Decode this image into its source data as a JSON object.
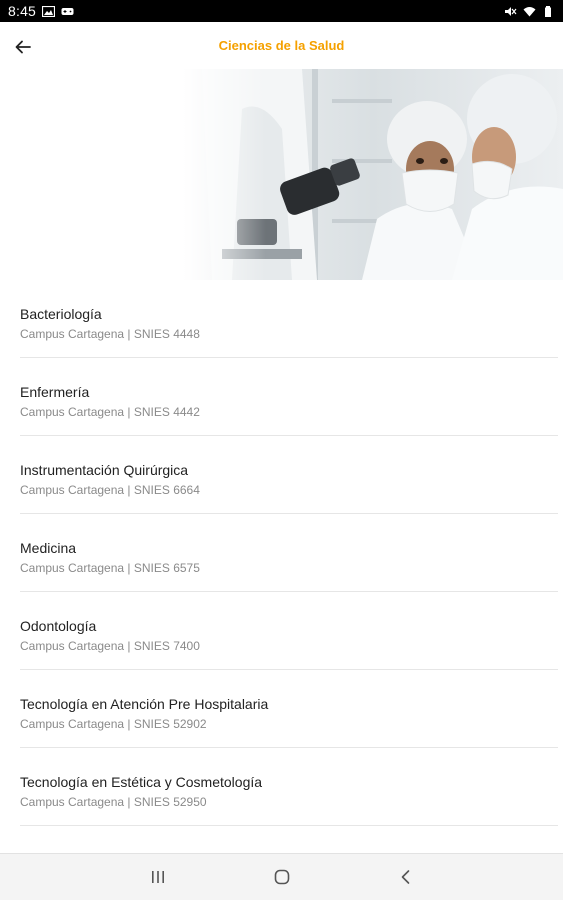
{
  "status_bar": {
    "time": "8:45",
    "icons": [
      "image-icon",
      "gamepad-icon",
      "mute-icon",
      "wifi-icon",
      "battery-icon"
    ]
  },
  "app_bar": {
    "title": "Ciencias de la Salud",
    "back_icon": "arrow-left-icon",
    "title_color": "#f5a100"
  },
  "hero": {
    "image": "laboratory-researchers-with-microscope"
  },
  "programs": [
    {
      "name": "Bacteriología",
      "details": "Campus Cartagena | SNIES 4448"
    },
    {
      "name": "Enfermería",
      "details": "Campus Cartagena | SNIES 4442"
    },
    {
      "name": "Instrumentación Quirúrgica",
      "details": "Campus Cartagena | SNIES 6664"
    },
    {
      "name": "Medicina",
      "details": "Campus Cartagena | SNIES 6575"
    },
    {
      "name": "Odontología",
      "details": "Campus Cartagena | SNIES 7400"
    },
    {
      "name": "Tecnología en Atención Pre Hospitalaria",
      "details": "Campus Cartagena | SNIES 52902"
    },
    {
      "name": "Tecnología en Estética y Cosmetología",
      "details": "Campus Cartagena | SNIES 52950"
    }
  ],
  "nav_bar": {
    "icons": [
      "recents-icon",
      "home-icon",
      "back-icon"
    ]
  }
}
